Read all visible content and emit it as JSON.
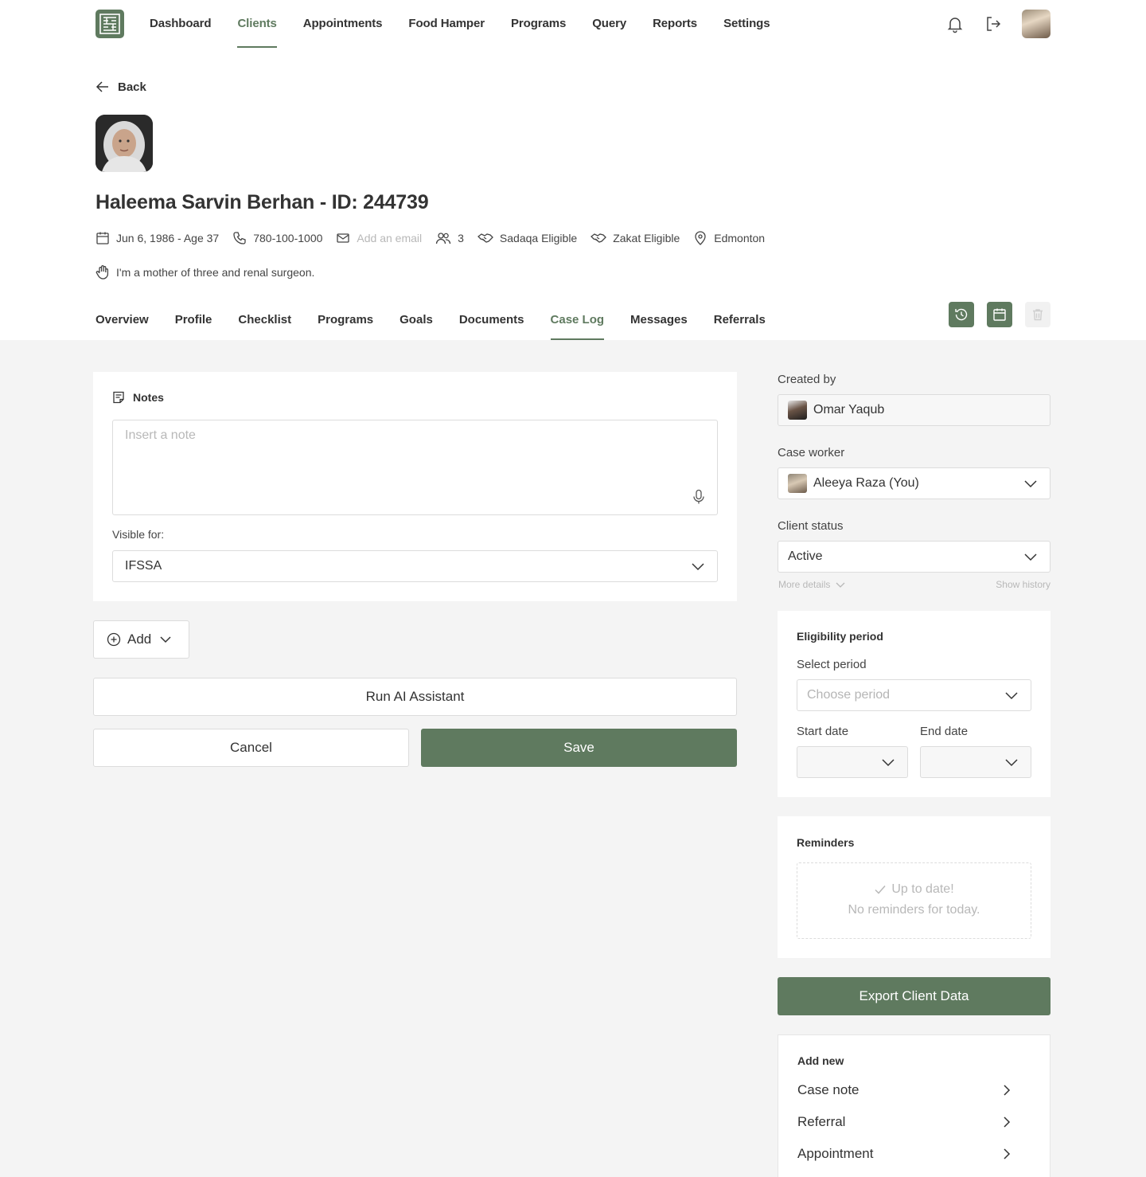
{
  "nav": {
    "items": [
      {
        "label": "Dashboard"
      },
      {
        "label": "Clients"
      },
      {
        "label": "Appointments"
      },
      {
        "label": "Food Hamper"
      },
      {
        "label": "Programs"
      },
      {
        "label": "Query"
      },
      {
        "label": "Reports"
      },
      {
        "label": "Settings"
      }
    ],
    "active": "Clients",
    "icons": [
      "bell-icon",
      "logout-icon"
    ]
  },
  "back_label": "Back",
  "client": {
    "name_line": "Haleema Sarvin Berhan - ID: 244739",
    "dob_age": "Jun 6, 1986 - Age 37",
    "phone": "780-100-1000",
    "email_placeholder": "Add an email",
    "household_count": "3",
    "sadaqa": "Sadaqa Eligible",
    "zakat": "Zakat Eligible",
    "city": "Edmonton",
    "bio": "I'm a mother of three and renal surgeon."
  },
  "tabs": {
    "items": [
      {
        "label": "Overview"
      },
      {
        "label": "Profile"
      },
      {
        "label": "Checklist"
      },
      {
        "label": "Programs"
      },
      {
        "label": "Goals"
      },
      {
        "label": "Documents"
      },
      {
        "label": "Case Log"
      },
      {
        "label": "Messages"
      },
      {
        "label": "Referrals"
      }
    ],
    "active": "Case Log",
    "action_icons": [
      "history-icon",
      "calendar-icon",
      "trash-icon"
    ]
  },
  "notes": {
    "title": "Notes",
    "placeholder": "Insert a note",
    "visible_label": "Visible for:",
    "visible_value": "IFSSA"
  },
  "actions": {
    "add_label": "Add",
    "ai_label": "Run AI Assistant",
    "cancel_label": "Cancel",
    "save_label": "Save"
  },
  "sidebar": {
    "created_by_label": "Created by",
    "created_by_value": "Omar Yaqub",
    "case_worker_label": "Case worker",
    "case_worker_value": "Aleeya Raza (You)",
    "status_label": "Client status",
    "status_value": "Active",
    "more_details": "More details",
    "show_history": "Show history",
    "eligibility": {
      "title": "Eligibility period",
      "select_label": "Select period",
      "select_placeholder": "Choose period",
      "start_label": "Start date",
      "end_label": "End date"
    },
    "reminders": {
      "title": "Reminders",
      "line1": "Up to date!",
      "line2": "No reminders for today."
    },
    "export_label": "Export Client Data",
    "add_new": {
      "title": "Add new",
      "items": [
        {
          "label": "Case note"
        },
        {
          "label": "Referral"
        },
        {
          "label": "Appointment"
        }
      ]
    }
  },
  "colors": {
    "accent": "#5f7a5f",
    "page_bg": "#f4f4f4",
    "muted_text": "#b8b8b8"
  }
}
